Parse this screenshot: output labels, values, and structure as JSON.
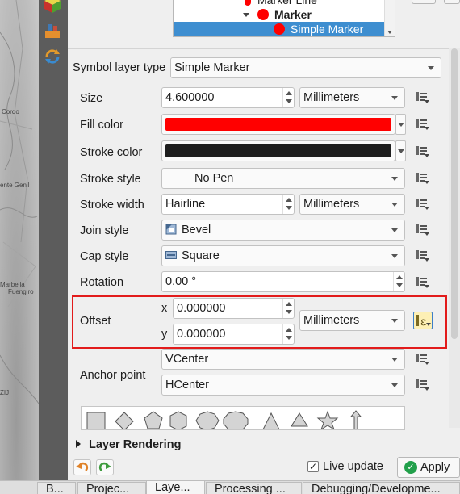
{
  "map": {
    "labels": [
      "Cordo",
      "ente Genil",
      "Marbella",
      "Fuengiro",
      "ZIJ"
    ]
  },
  "symbol_tree": {
    "items": [
      {
        "label": "Marker Line",
        "indent": 2,
        "selected": false
      },
      {
        "label": "Marker",
        "indent": 1,
        "selected": false,
        "bold": true
      },
      {
        "label": "Simple Marker",
        "indent": 2,
        "selected": true
      }
    ]
  },
  "symbol_layer_type": {
    "label": "Symbol layer type",
    "value": "Simple Marker"
  },
  "properties": {
    "size": {
      "label": "Size",
      "value": "4.600000",
      "unit": "Millimeters"
    },
    "fill_color": {
      "label": "Fill color",
      "color": "#ff0000"
    },
    "stroke_color": {
      "label": "Stroke color",
      "color": "#1e1e1e"
    },
    "stroke_style": {
      "label": "Stroke style",
      "value": "No Pen"
    },
    "stroke_width": {
      "label": "Stroke width",
      "value": "Hairline",
      "unit": "Millimeters"
    },
    "join_style": {
      "label": "Join style",
      "value": "Bevel"
    },
    "cap_style": {
      "label": "Cap style",
      "value": "Square"
    },
    "rotation": {
      "label": "Rotation",
      "value": "0.00 °"
    },
    "offset": {
      "label": "Offset",
      "x_label": "x",
      "x_value": "0.000000",
      "y_label": "y",
      "y_value": "0.000000",
      "unit": "Millimeters"
    },
    "anchor_point": {
      "label": "Anchor point",
      "vertical": "VCenter",
      "horizontal": "HCenter"
    }
  },
  "marker_shapes": [
    "square",
    "diamond",
    "pentagon",
    "hexagon",
    "octagon",
    "decagon",
    "triangle",
    "equilateral-triangle",
    "star",
    "arrow"
  ],
  "layer_rendering": {
    "label": "Layer Rendering"
  },
  "footer": {
    "live_update_label": "Live update",
    "live_update_checked": true,
    "apply_label": "Apply"
  },
  "tabs": [
    {
      "label": "B...",
      "active": false
    },
    {
      "label": "Projec...",
      "active": false
    },
    {
      "label": "Laye...",
      "active": true
    },
    {
      "label": "Processing ...",
      "active": false
    },
    {
      "label": "Debugging/Developme...",
      "active": false
    }
  ],
  "colors": {
    "selection": "#3e8ed0",
    "highlight_border": "#e21b1b",
    "apply_icon": "#22a04b"
  }
}
